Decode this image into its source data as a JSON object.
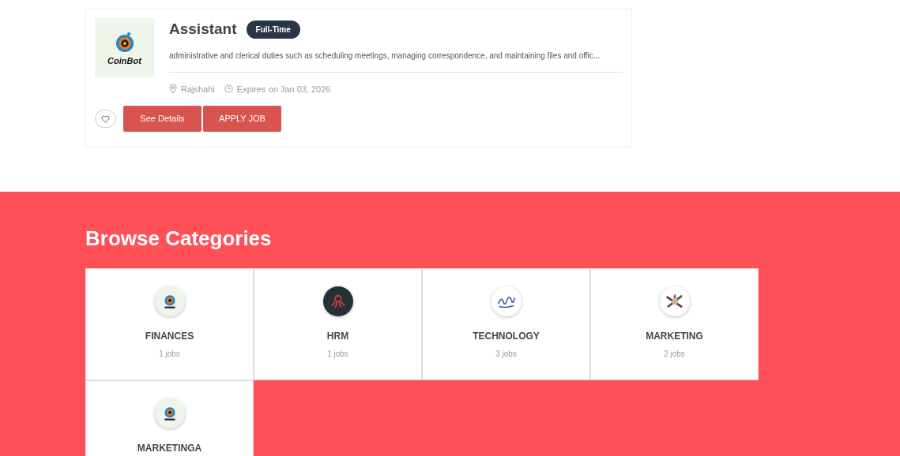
{
  "job": {
    "company_logo_text": "CoinBot",
    "title": "Assistant",
    "type_badge": "Full-Time",
    "description": "administrative and clerical duties such as scheduling meetings, managing correspondence, and maintaining files and offic...",
    "location": "Rajshahi",
    "expiry": "Expires on Jan 03, 2026",
    "favorite": false,
    "buttons": [
      "See Details",
      "APPLY JOB"
    ]
  },
  "categories_section": {
    "title": "Browse Categories",
    "categories": [
      {
        "kind": "coin",
        "name": "FINANCES",
        "count": "1 jobs"
      },
      {
        "kind": "octopus",
        "name": "HRM",
        "count": "1 jobs"
      },
      {
        "kind": "script",
        "name": "TECHNOLOGY",
        "count": "3 jobs"
      },
      {
        "kind": "tools",
        "name": "MARKETING",
        "count": "2 jobs"
      },
      {
        "kind": "coin",
        "name": "MARKETINGA"
      }
    ]
  }
}
